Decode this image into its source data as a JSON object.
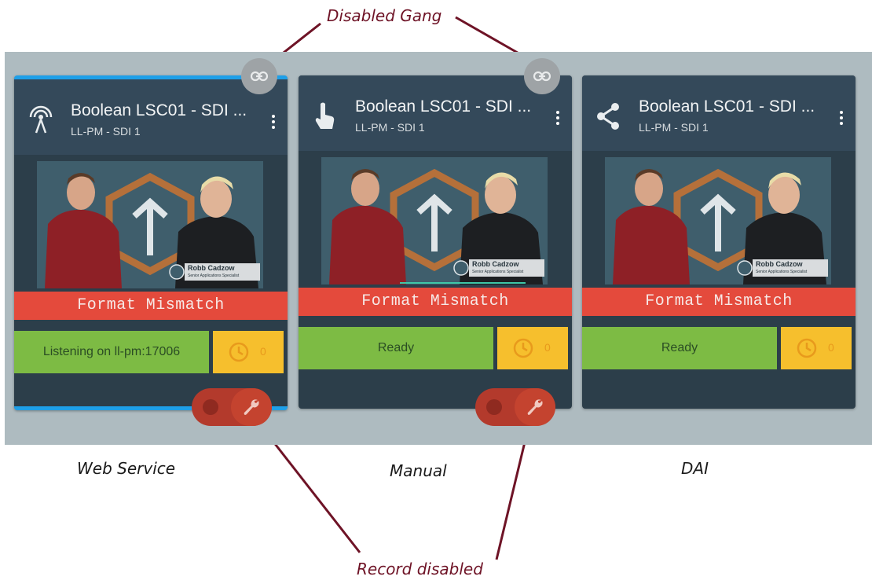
{
  "annotations": {
    "top": "Disabled Gang",
    "bottom": "Record disabled"
  },
  "cards": [
    {
      "title": "Boolean LSC01 - SDI ...",
      "subtitle": "LL-PM - SDI 1",
      "icon": "broadcast-tower-icon",
      "status": "Format Mismatch",
      "ready": "Listening on ll-pm:17006",
      "timer": "0",
      "video_caption": "Robb Cadzow",
      "video_subcaption": "Senior Applications Specialist",
      "caption": "Web Service"
    },
    {
      "title": "Boolean LSC01 - SDI ...",
      "subtitle": "LL-PM - SDI 1",
      "icon": "touch-hand-icon",
      "status": "Format Mismatch",
      "ready": "Ready",
      "timer": "0",
      "video_caption": "Robb Cadzow",
      "video_subcaption": "Senior Applications Specialist",
      "caption": "Manual"
    },
    {
      "title": "Boolean LSC01 - SDI ...",
      "subtitle": "LL-PM - SDI 1",
      "icon": "share-icon",
      "status": "Format Mismatch",
      "ready": "Ready",
      "timer": "0",
      "video_caption": "Robb Cadzow",
      "video_subcaption": "Senior Applications Specialist",
      "caption": "DAI"
    }
  ],
  "colors": {
    "panel": "#aebbc0",
    "card": "#2c3e4a",
    "status_error": "#e44a3c",
    "ready": "#7dbb44",
    "timer": "#f6bf2d",
    "record": "#b33a2c",
    "annotation": "#6e1326",
    "selected_border": "#1e9fe8"
  }
}
